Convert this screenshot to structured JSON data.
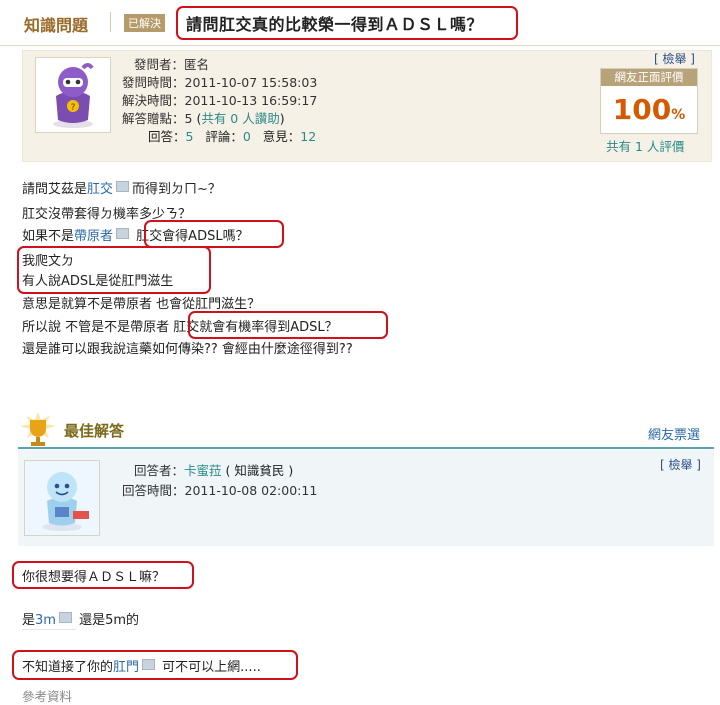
{
  "header": {
    "site_title": "知識問題",
    "status_badge": "已解決",
    "question_title": "請問肛交真的比較榮一得到ＡＤＳＬ嗎？"
  },
  "question_info": {
    "asker_label": "發問者：",
    "asker": "匿名",
    "asked_time_label": "發問時間：",
    "asked_time": "2011-10-07 15:58:03",
    "solved_time_label": "解決時間：",
    "solved_time": "2011-10-13 16:59:17",
    "points_label": "解答贈點：",
    "points": "5",
    "points_detail_open": " (",
    "points_detail": "共有 0 人讚助",
    "points_detail_close": ")",
    "answers_label": "回答：",
    "answers": "5",
    "comments_label": "評論：",
    "comments": "0",
    "opinions_label": "意見：",
    "opinions": "12",
    "report": "[ 檢舉 ]",
    "rating_head": "網友正面評價",
    "rating_value": "100",
    "rating_unit": "%",
    "rating_count": "共有 1 人評價"
  },
  "question_body": {
    "l1_a": "請問艾茲是",
    "l1_kw": "肛交",
    "l1_b": "而得到ㄉㄇ~？",
    "l2": "肛交沒帶套得ㄉ機率多少ㄋ？",
    "l3_a": "如果不是",
    "l3_kw": "帶原者",
    "l3_b": "肛交會得ADSL嗎？",
    "l4": "我爬文ㄉ",
    "l5": " 有人說ADSL是從肛門滋生",
    "l6": "意思是就算不是帶原者 也會從肛門滋生？",
    "l7_a": "所以說 不管是不是帶原者 ",
    "l7_b": "肛交就會有機率得到ADSL？",
    "l8": "還是誰可以跟我說這藥如何傳染?? 會經由什麼途徑得到??"
  },
  "best_answer": {
    "section_title": "最佳解答",
    "vote_label": "網友票選",
    "report": "[ 檢舉 ]",
    "answerer_label": "回答者：",
    "answerer": "卡蜜菈",
    "answerer_level": " ( 知識貧民 )",
    "answer_time_label": "回答時間：",
    "answer_time": "2011-10-08 02:00:11",
    "l1": "你很想要得ＡＤＳＬ嘛？",
    "l2_a": "是",
    "l2_kw": "3m",
    "l2_b": "還是5m的",
    "l3_a": "不知道接了你的",
    "l3_kw": "肛門",
    "l3_b": "可不可以上網.....",
    "ref_label": "參考資料"
  },
  "colors": {
    "highlight_border": "#d0101a",
    "keyword_link": "#2a6aa8",
    "rating_orange": "#d35a00",
    "teal": "#2a8a8a"
  }
}
